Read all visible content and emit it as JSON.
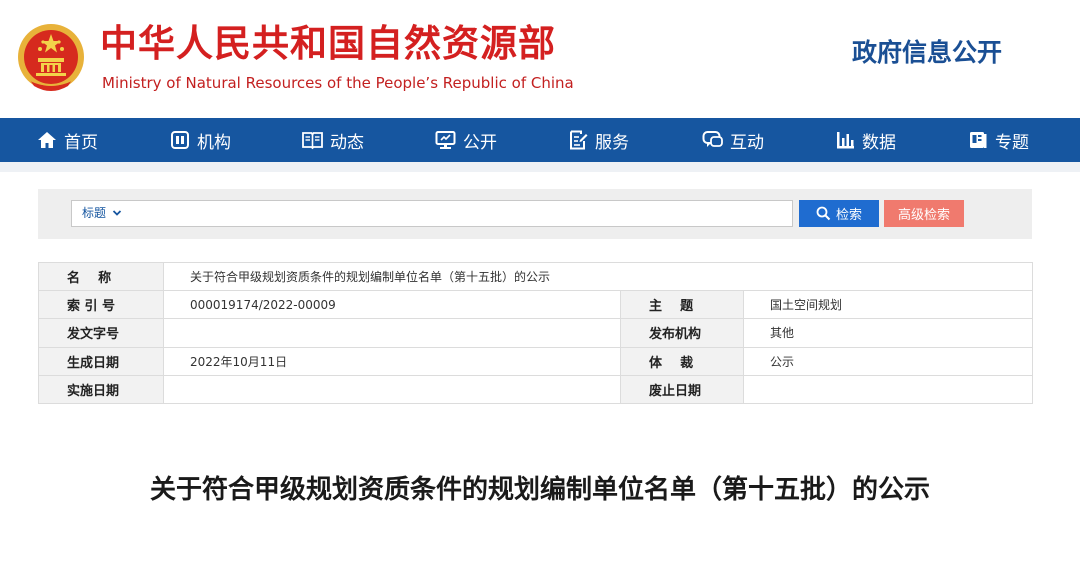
{
  "header": {
    "title_cn": "中华人民共和国自然资源部",
    "title_en": "Ministry of Natural Resources of the People’s Republic of China",
    "gov_info": "政府信息公开",
    "emblem_icon": "national-emblem-icon"
  },
  "nav": {
    "items": [
      {
        "label": "首页",
        "icon": "home-icon"
      },
      {
        "label": "机构",
        "icon": "org-icon"
      },
      {
        "label": "动态",
        "icon": "book-icon"
      },
      {
        "label": "公开",
        "icon": "monitor-icon"
      },
      {
        "label": "服务",
        "icon": "document-edit-icon"
      },
      {
        "label": "互动",
        "icon": "chat-icon"
      },
      {
        "label": "数据",
        "icon": "bar-chart-icon"
      },
      {
        "label": "专题",
        "icon": "topic-icon"
      }
    ]
  },
  "search": {
    "field_label": "标题",
    "query": "",
    "search_label": "检索",
    "advanced_label": "高级检索"
  },
  "info": {
    "name_label": "名    称",
    "name_value": "关于符合甲级规划资质条件的规划编制单位名单（第十五批）的公示",
    "index_label": "索 引 号",
    "index_value": "000019174/2022-00009",
    "subject_label": "主    题",
    "subject_value": "国土空间规划",
    "doc_no_label": "发文字号",
    "doc_no_value": "",
    "issuer_label": "发布机构",
    "issuer_value": "其他",
    "date_label": "生成日期",
    "date_value": "2022年10月11日",
    "genre_label": "体    裁",
    "genre_value": "公示",
    "effective_label": "实施日期",
    "effective_value": "",
    "expiry_label": "废止日期",
    "expiry_value": ""
  },
  "article": {
    "title": "关于符合甲级规划资质条件的规划编制单位名单（第十五批）的公示"
  },
  "colors": {
    "brand_red": "#d42020",
    "nav_blue": "#1656a0",
    "search_blue": "#1f6cd0",
    "advanced_salmon": "#f07a6e"
  }
}
